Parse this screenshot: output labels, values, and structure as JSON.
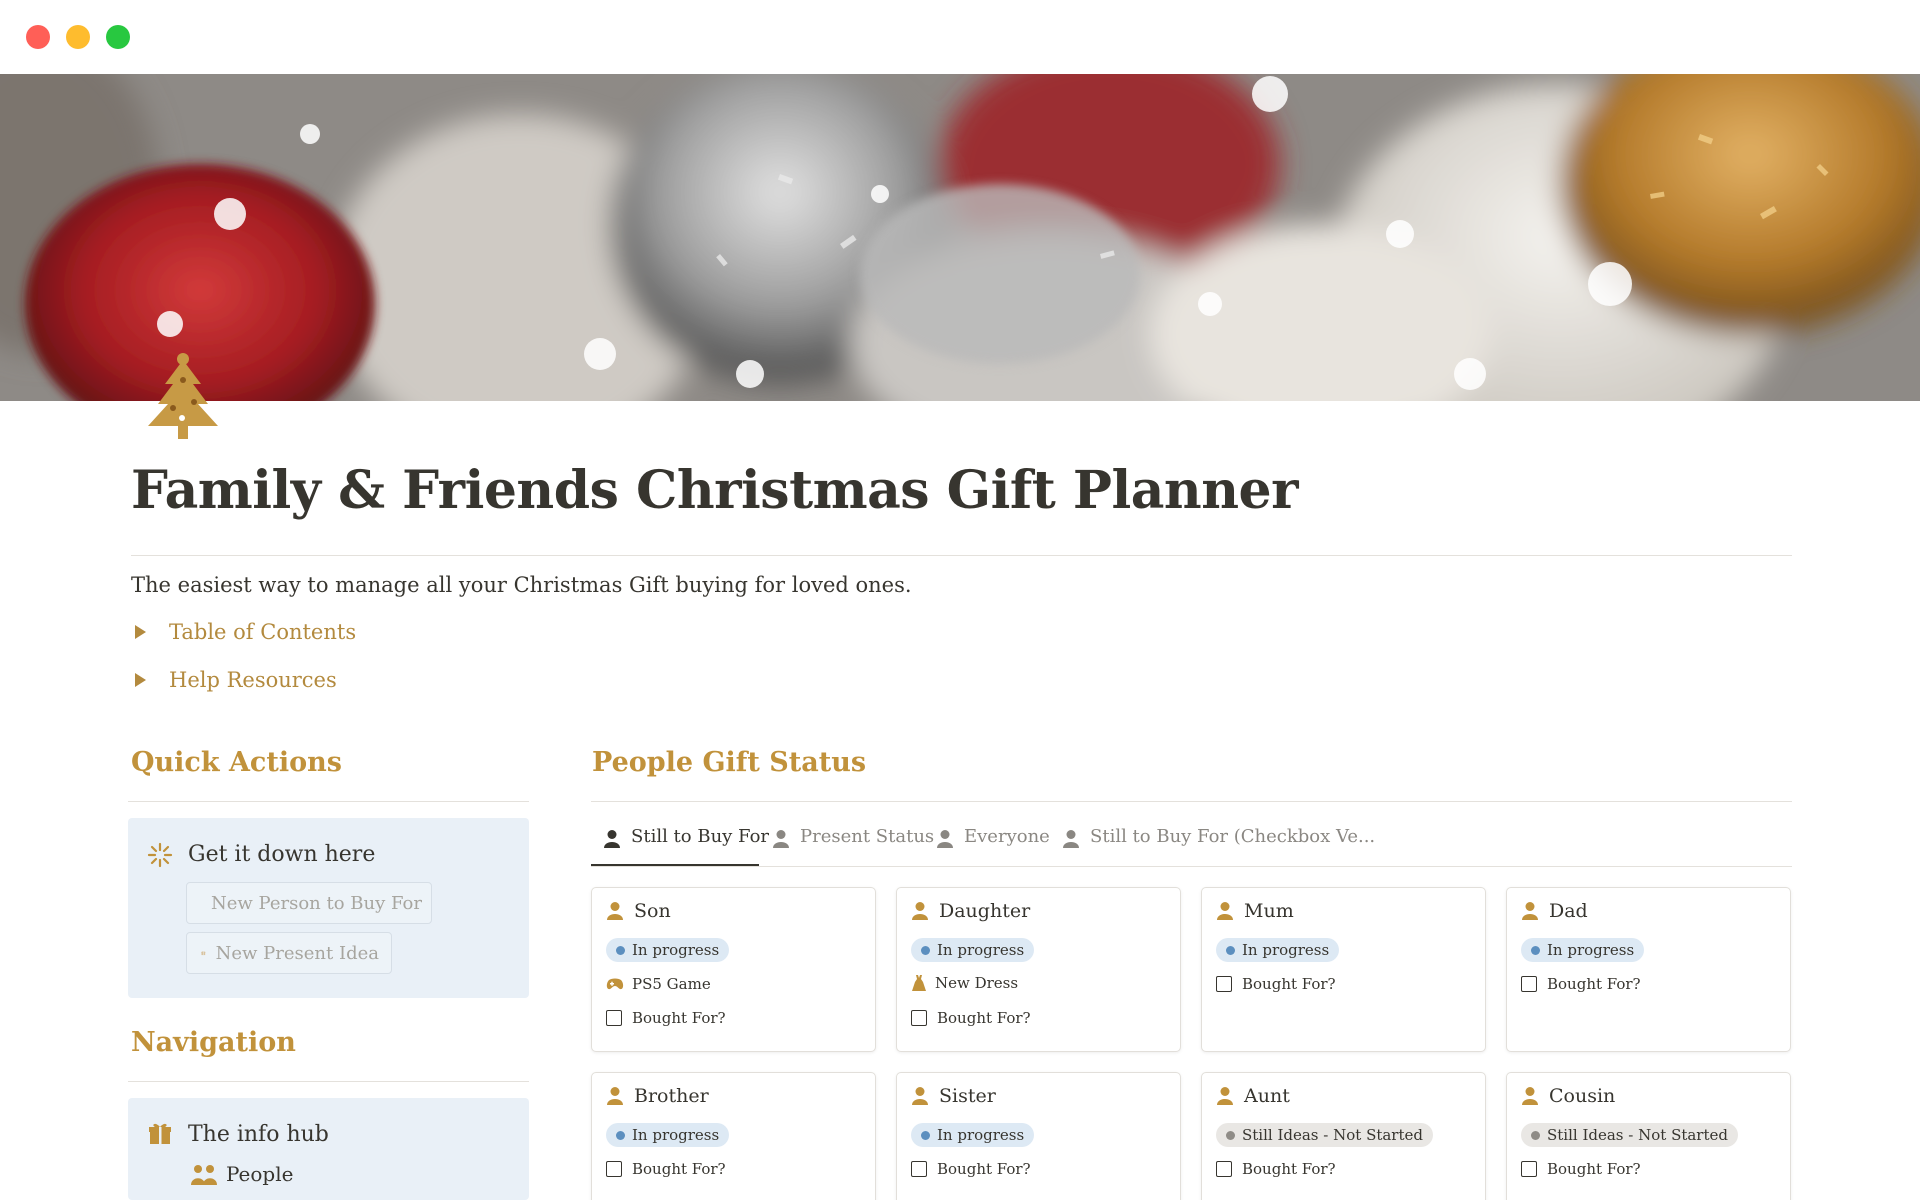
{
  "window": {
    "controls": [
      "close",
      "minimize",
      "zoom"
    ]
  },
  "page": {
    "icon": "christmas-tree-icon",
    "title": "Family & Friends Christmas Gift Planner",
    "description": "The easiest way to manage all your Christmas Gift buying for loved ones.",
    "toggles": [
      {
        "label": "Table of Contents"
      },
      {
        "label": "Help Resources"
      }
    ]
  },
  "quick_actions": {
    "heading": "Quick Actions",
    "callout_title": "Get it down here",
    "callout_icon": "sparkle-icon",
    "buttons": [
      {
        "label": "New Person to Buy For",
        "icon": "person-icon"
      },
      {
        "label": "New Present Idea",
        "icon": "gift-icon"
      }
    ]
  },
  "navigation": {
    "heading": "Navigation",
    "callout_title": "The info hub",
    "callout_icon": "gift-icon",
    "items": [
      {
        "label": "People",
        "icon": "people-icon"
      }
    ]
  },
  "gift_status": {
    "heading": "People Gift Status",
    "tabs": [
      {
        "label": "Still to Buy For",
        "active": true
      },
      {
        "label": "Present Status",
        "active": false
      },
      {
        "label": "Everyone",
        "active": false
      },
      {
        "label": "Still to Buy For (Checkbox Ve...",
        "active": false
      }
    ],
    "cards": [
      {
        "name": "Son",
        "status": "In progress",
        "present": "PS5 Game",
        "present_icon": "gamepad-icon",
        "checkbox": "Bought For?"
      },
      {
        "name": "Daughter",
        "status": "In progress",
        "present": "New Dress",
        "present_icon": "dress-icon",
        "checkbox": "Bought For?"
      },
      {
        "name": "Mum",
        "status": "In progress",
        "checkbox": "Bought For?"
      },
      {
        "name": "Dad",
        "status": "In progress",
        "checkbox": "Bought For?"
      },
      {
        "name": "Brother",
        "status": "In progress",
        "checkbox": "Bought For?"
      },
      {
        "name": "Sister",
        "status": "In progress",
        "checkbox": "Bought For?"
      },
      {
        "name": "Aunt",
        "status": "Still Ideas - Not Started",
        "checkbox": "Bought For?"
      },
      {
        "name": "Cousin",
        "status": "Still Ideas - Not Started",
        "checkbox": "Bought For?"
      }
    ]
  },
  "colors": {
    "accent_gold": "#c1923b",
    "callout_bg": "#e9f0f7",
    "status_in_progress": "#dde9f4",
    "status_not_started": "#e9e7e4"
  }
}
